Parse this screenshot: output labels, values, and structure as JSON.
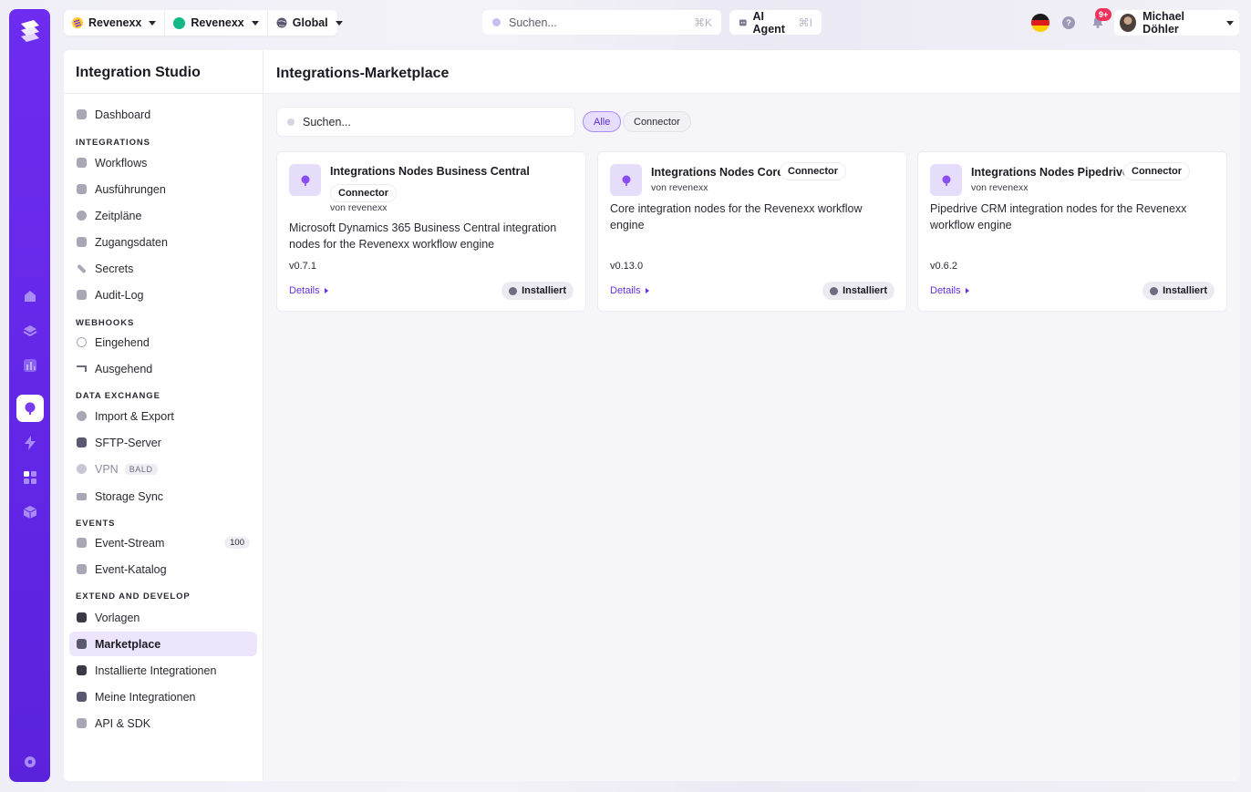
{
  "topbar": {
    "selectors": [
      {
        "label": "Revenexx",
        "icon": "brand-stripes-icon"
      },
      {
        "label": "Revenexx",
        "icon": "green-dot-icon"
      },
      {
        "label": "Global",
        "icon": "globe-icon"
      }
    ],
    "search_placeholder": "Suchen...",
    "search_shortcut": "⌘K",
    "ai_agent_label": "AI Agent",
    "ai_agent_shortcut": "⌘I",
    "notification_count": "9+",
    "user_name": "Michael Döhler"
  },
  "sidebar": {
    "title": "Integration Studio",
    "items": [
      {
        "label": "Dashboard"
      },
      {
        "section": "INTEGRATIONS"
      },
      {
        "label": "Workflows"
      },
      {
        "label": "Ausführungen"
      },
      {
        "label": "Zeitpläne"
      },
      {
        "label": "Zugangsdaten"
      },
      {
        "label": "Secrets"
      },
      {
        "label": "Audit-Log"
      },
      {
        "section": "WEBHOOKS"
      },
      {
        "label": "Eingehend"
      },
      {
        "label": "Ausgehend"
      },
      {
        "section": "DATA EXCHANGE"
      },
      {
        "label": "Import & Export"
      },
      {
        "label": "SFTP-Server"
      },
      {
        "label": "VPN",
        "badge": "BALD"
      },
      {
        "label": "Storage Sync"
      },
      {
        "section": "EVENTS"
      },
      {
        "label": "Event-Stream",
        "count": "100"
      },
      {
        "label": "Event-Katalog"
      },
      {
        "section": "EXTEND AND DEVELOP"
      },
      {
        "label": "Vorlagen"
      },
      {
        "label": "Marketplace"
      },
      {
        "label": "Installierte Integrationen"
      },
      {
        "label": "Meine Integrationen"
      },
      {
        "label": "API & SDK"
      }
    ]
  },
  "main": {
    "title": "Integrations-Marketplace",
    "search_placeholder": "Suchen...",
    "filters": [
      "Alle",
      "Connector"
    ],
    "cards": [
      {
        "title": "Integrations Nodes Business Central",
        "tag": "Connector",
        "author": "von revenexx",
        "description": "Microsoft Dynamics 365 Business Central integration nodes for the Revenexx workflow engine",
        "version": "v0.7.1",
        "details_label": "Details",
        "status": "Installiert"
      },
      {
        "title": "Integrations Nodes Core",
        "tag": "Connector",
        "author": "von revenexx",
        "description": "Core integration nodes for the Revenexx workflow engine",
        "version": "v0.13.0",
        "details_label": "Details",
        "status": "Installiert"
      },
      {
        "title": "Integrations Nodes Pipedrive",
        "tag": "Connector",
        "author": "von revenexx",
        "description": "Pipedrive CRM integration nodes for the Revenexx workflow engine",
        "version": "v0.6.2",
        "details_label": "Details",
        "status": "Installiert"
      }
    ]
  },
  "colors": {
    "accent": "#6d2cf0",
    "active_bg": "#ece5fc",
    "badge": "#f0325a"
  }
}
